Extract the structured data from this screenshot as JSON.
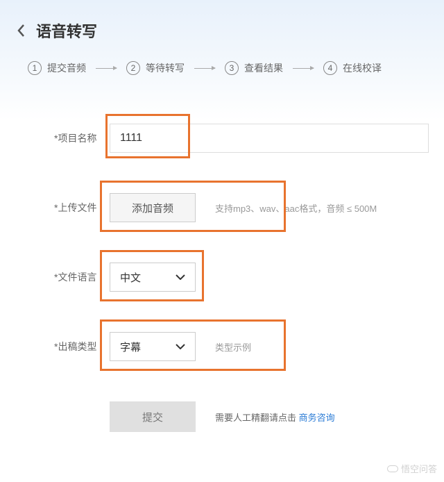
{
  "header": {
    "title": "语音转写"
  },
  "steps": [
    {
      "num": "1",
      "label": "提交音频"
    },
    {
      "num": "2",
      "label": "等待转写"
    },
    {
      "num": "3",
      "label": "查看结果"
    },
    {
      "num": "4",
      "label": "在线校译"
    }
  ],
  "form": {
    "project_name": {
      "label": "*项目名称",
      "value": "1111"
    },
    "upload": {
      "label": "*上传文件",
      "button": "添加音频",
      "hint": "支持mp3、wav、aac格式，音频 ≤ 500M"
    },
    "language": {
      "label": "*文件语言",
      "value": "中文"
    },
    "output_type": {
      "label": "*出稿类型",
      "value": "字幕",
      "example": "类型示例"
    },
    "submit": {
      "label": "提交"
    },
    "footer": {
      "text": "需要人工精翻请点击 ",
      "link": "商务咨询"
    }
  },
  "watermark": "悟空问答",
  "colors": {
    "highlight": "#e8732e",
    "link": "#2b7cd6"
  }
}
